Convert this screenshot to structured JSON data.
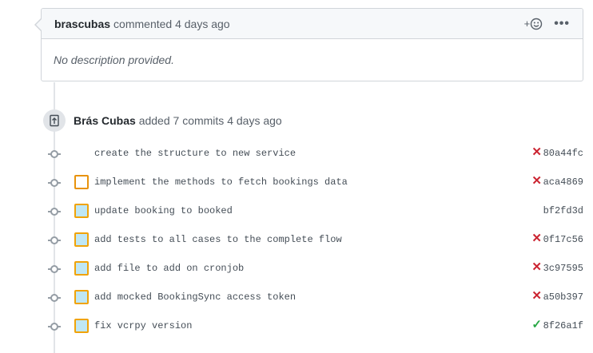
{
  "comment": {
    "author": "brascubas",
    "action": "commented",
    "time": "4 days ago",
    "reaction_plus": "+",
    "more_label": "•••",
    "body": "No description provided."
  },
  "event": {
    "actor": "Brás Cubas",
    "action": "added 7 commits",
    "time": "4 days ago"
  },
  "commits": [
    {
      "message": "create the structure to new service",
      "sha": "80a44fc",
      "status": "fail",
      "avatar": "none"
    },
    {
      "message": "implement the methods to fetch bookings data",
      "sha": "aca4869",
      "status": "fail",
      "avatar": "hollow"
    },
    {
      "message": "update booking to booked",
      "sha": "bf2fd3d",
      "status": "none",
      "avatar": "filled"
    },
    {
      "message": "add tests to all cases to the complete flow",
      "sha": "0f17c56",
      "status": "fail",
      "avatar": "filled"
    },
    {
      "message": "add file to add on cronjob",
      "sha": "3c97595",
      "status": "fail",
      "avatar": "filled"
    },
    {
      "message": "add mocked BookingSync access token",
      "sha": "a50b397",
      "status": "fail",
      "avatar": "filled"
    },
    {
      "message": "fix vcrpy version",
      "sha": "8f26a1f",
      "status": "success",
      "avatar": "filled"
    }
  ],
  "status_icons": {
    "fail": "✕",
    "success": "✓"
  },
  "colors": {
    "fail": "#cb2431",
    "success": "#28a745",
    "avatar_border": "#f0a30a",
    "avatar_fill": "#bfe7f5"
  }
}
